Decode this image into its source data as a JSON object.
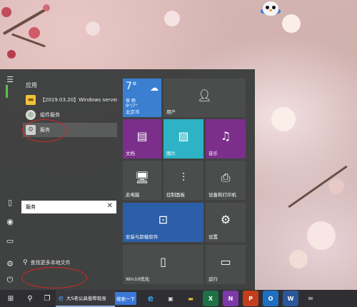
{
  "start_menu": {
    "section_letter": "应用",
    "apps": [
      {
        "label": "【2019.03.20】Windows server...",
        "icon": "folder-icon"
      },
      {
        "label": "组件服务",
        "icon": "component-services-icon"
      },
      {
        "label": "服务",
        "icon": "services-gear-icon"
      }
    ],
    "search_hint": "查找更多本地文件",
    "search_value": "服务",
    "tiles": {
      "weather": {
        "temp": "7°",
        "condition": "夜 雨",
        "range": "9°/7°",
        "location": "北京市"
      },
      "user": "用户",
      "documents": "文档",
      "pictures": "图片",
      "music": "音乐",
      "this_pc": "此电脑",
      "control_panel": "控制面板",
      "devices_printers": "设备和打印机",
      "install_uninstall": "安装与卸载软件",
      "settings": "设置",
      "win10": "Win10优化",
      "run": "运行"
    }
  },
  "taskbar": {
    "browser_title": "大S老公具俊晔现身",
    "search_button": "搜索一下"
  },
  "colors": {
    "start_bg": "#3a3c3c",
    "tile_blue": "#2f6fc1",
    "tile_purple": "#7b2f8b",
    "tile_teal": "#2db3c5",
    "tile_dark": "#4b4d4d",
    "annotation_red": "#d62828"
  }
}
